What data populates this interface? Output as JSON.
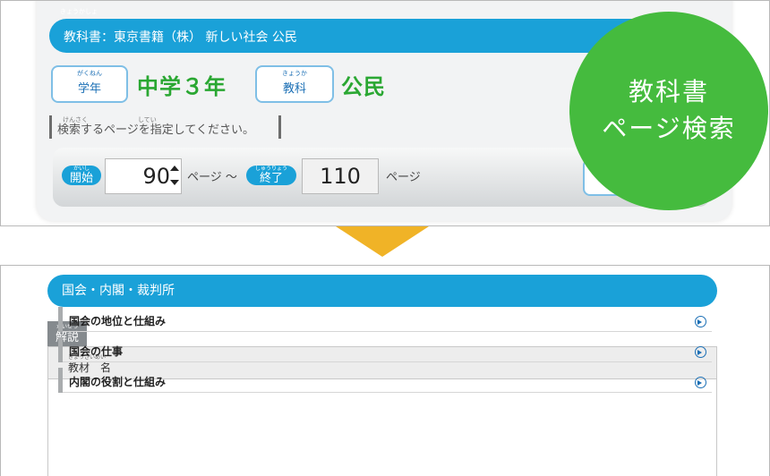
{
  "search_form": {
    "textbook_ruby": "きょうかしょ",
    "textbook_title": "教科書：東京書籍（株） 新しい社会 公民",
    "grade_ruby": "がくねん",
    "grade_label": "学年",
    "grade_value": "中学３年",
    "subject_ruby": "きょうか",
    "subject_label": "教科",
    "subject_value": "公民",
    "instruction_ruby": "けんさく　　　　　　　　してい",
    "instruction": "検索するページを指定してください。",
    "start_ruby": "かいし",
    "start_label": "開始",
    "start_page": "90",
    "page_unit_start": "ページ ～",
    "end_ruby": "しゅうりょう",
    "end_label": "終了",
    "end_page": "110",
    "page_unit_end": "ページ"
  },
  "badge": {
    "line1": "教科書",
    "line2": "ページ検索"
  },
  "results": {
    "section_title": "国会・内閣・裁判所",
    "tab_ruby": "かいせつ",
    "tab_label": "解説",
    "header_ruby": "きょうざいめい",
    "header_label": "教材　名",
    "rows": [
      {
        "label": "国会の地位と仕組み"
      },
      {
        "label": "国会の仕事"
      },
      {
        "label": "内閣の役割と仕組み"
      }
    ]
  },
  "colors": {
    "accent_blue": "#1aa1d8",
    "badge_green": "#45bb3e",
    "grade_green": "#2aa732",
    "arrow_orange": "#f0b327"
  }
}
